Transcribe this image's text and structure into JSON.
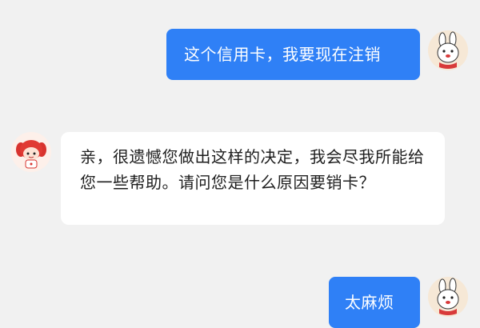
{
  "conversation": {
    "messages": [
      {
        "sender": "user",
        "text": "这个信用卡，我要现在注销"
      },
      {
        "sender": "agent",
        "text": "亲，很遗憾您做出这样的决定，我会尽我所能给您一些帮助。请问您是什么原因要销卡？"
      },
      {
        "sender": "user",
        "text": "太麻烦"
      }
    ]
  },
  "avatars": {
    "user": {
      "icon": "rabbit-mascot-icon"
    },
    "agent": {
      "icon": "red-hair-girl-icon"
    }
  },
  "colors": {
    "background": "#f1f1f1",
    "outgoing_bubble": "#2f80f6",
    "incoming_bubble": "#ffffff",
    "outgoing_text": "#ffffff",
    "incoming_text": "#1e1e1e"
  }
}
